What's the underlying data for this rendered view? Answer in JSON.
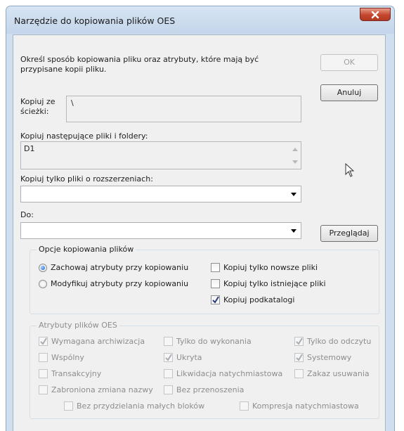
{
  "window": {
    "title": "Narzędzie do kopiowania plików OES"
  },
  "description": "Określ sposób kopiowania pliku oraz atrybuty, które mają być przypisane kopii pliku.",
  "buttons": {
    "ok": "OK",
    "cancel": "Anuluj",
    "browse": "Przeglądaj"
  },
  "source": {
    "label": "Kopiuj ze ścieżki:",
    "value": "\\"
  },
  "files": {
    "label": "Kopiuj następujące pliki i foldery:",
    "value": "D1"
  },
  "extensions": {
    "label": "Kopiuj tylko pliki o rozszerzeniach:",
    "value": ""
  },
  "destination": {
    "label": "Do:",
    "value": ""
  },
  "copy_options": {
    "title": "Opcje kopiowania plików",
    "preserve_attributes": {
      "label": "Zachowaj atrybuty przy kopiowaniu",
      "selected": true
    },
    "modify_attributes": {
      "label": "Modyfikuj atrybuty przy kopiowaniu",
      "selected": false
    },
    "newer_only": {
      "label": "Kopiuj tylko nowsze pliki",
      "checked": false
    },
    "existing_only": {
      "label": "Kopiuj tylko istniejące pliki",
      "checked": false
    },
    "subdirectories": {
      "label": "Kopiuj podkatalogi",
      "checked": true
    }
  },
  "attributes": {
    "title": "Atrybuty plików OES",
    "items": [
      {
        "label": "Wymagana archiwizacja",
        "checked": true
      },
      {
        "label": "Tylko do wykonania",
        "checked": false
      },
      {
        "label": "Tylko do odczytu",
        "checked": true
      },
      {
        "label": "Wspólny",
        "checked": false
      },
      {
        "label": "Ukryta",
        "checked": true
      },
      {
        "label": "Systemowy",
        "checked": true
      },
      {
        "label": "Transakcyjny",
        "checked": false
      },
      {
        "label": "Likwidacja natychmiastowa",
        "checked": false
      },
      {
        "label": "Zakaz usuwania",
        "checked": false
      },
      {
        "label": "Zabroniona zmiana nazwy",
        "checked": false
      },
      {
        "label": "Bez przenoszenia",
        "checked": false
      },
      {
        "label": "Bez przydzielania małych bloków",
        "checked": false
      },
      {
        "label": "Kompresja natychmiastowa",
        "checked": false
      }
    ]
  }
}
